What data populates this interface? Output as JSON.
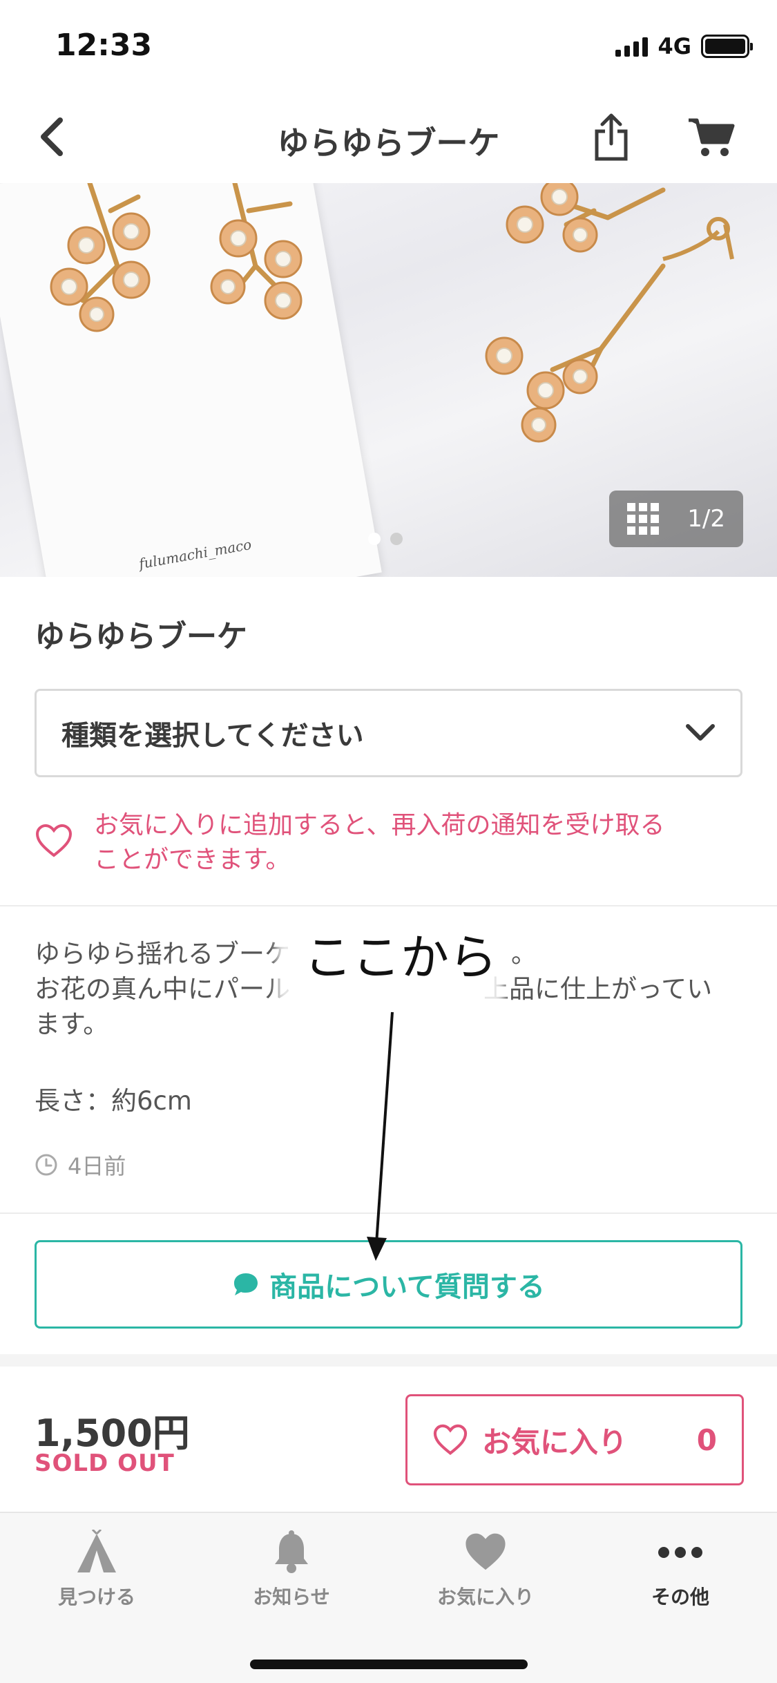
{
  "status_bar": {
    "time": "12:33",
    "network": "4G"
  },
  "nav": {
    "title": "ゆらゆらブーケ"
  },
  "hero": {
    "counter": "1/2",
    "card_text": "fulumachi_maco",
    "page_count": 2,
    "current_page": 1
  },
  "product": {
    "name": "ゆらゆらブーケ",
    "variant_placeholder": "種類を選択してください",
    "favorite_notice": [
      "お気に入りに追加すると、再入荷の通知を受け取る",
      "ことができます。"
    ],
    "description": [
      "ゆらゆら揺れるブーケ",
      "。",
      "お花の真ん中にパール",
      "上品に仕上がってい",
      "ます。"
    ],
    "length": "長さ：約6cm",
    "posted": "4日前",
    "ask_label": "商品について質問する",
    "price": "1,500円",
    "status": "SOLD OUT",
    "favorite_label": "お気に入り",
    "favorite_count": "0"
  },
  "annotation": {
    "text": "ここから"
  },
  "tabs": [
    {
      "label": "見つける",
      "icon": "tent-icon"
    },
    {
      "label": "お知らせ",
      "icon": "bell-icon"
    },
    {
      "label": "お気に入り",
      "icon": "heart-icon"
    },
    {
      "label": "その他",
      "icon": "more-icon"
    }
  ],
  "colors": {
    "accent_pink": "#e0527a",
    "accent_teal": "#2bb6a5",
    "text_dark": "#3a3a3a"
  }
}
